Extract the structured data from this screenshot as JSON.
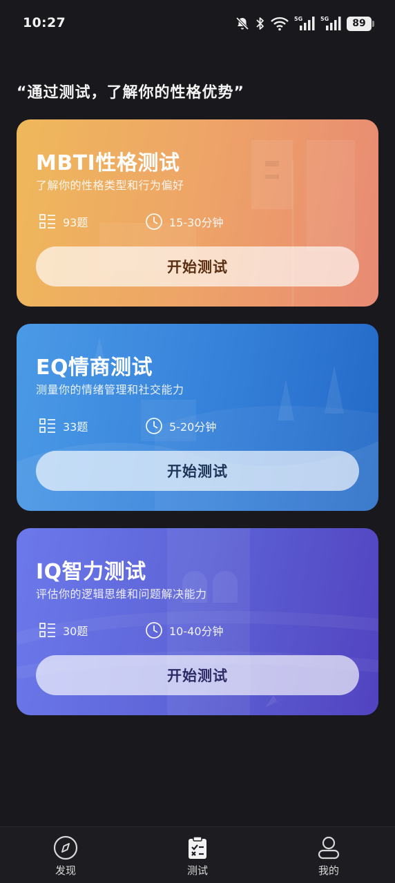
{
  "status_bar": {
    "time": "10:27",
    "icons": [
      "mute-bell-icon",
      "bluetooth-icon",
      "wifi-icon",
      "signal-5g-icon",
      "signal-5g-icon",
      "battery-icon"
    ],
    "network_label": "5G",
    "battery_level": "89"
  },
  "heading": "“通过测试，了解你的性格优势”",
  "tests": [
    {
      "title": "MBTI性格测试",
      "subtitle": "了解你的性格类型和行为偏好",
      "questions": "93题",
      "duration": "15-30分钟",
      "button": "开始测试",
      "colors": [
        "#efb85b",
        "#e88a74"
      ]
    },
    {
      "title": "EQ情商测试",
      "subtitle": "测量你的情绪管理和社交能力",
      "questions": "33题",
      "duration": "5-20分钟",
      "button": "开始测试",
      "colors": [
        "#4b9ae6",
        "#2369c7"
      ]
    },
    {
      "title": "IQ智力测试",
      "subtitle": "评估你的逻辑思维和问题解决能力",
      "questions": "30题",
      "duration": "10-40分钟",
      "button": "开始测试",
      "colors": [
        "#6c79ea",
        "#5243c0"
      ]
    }
  ],
  "bottom_nav": {
    "items": [
      {
        "label": "发现",
        "icon": "compass-icon"
      },
      {
        "label": "测试",
        "icon": "clipboard-check-icon",
        "active": true
      },
      {
        "label": "我的",
        "icon": "person-icon"
      }
    ]
  },
  "colors": {
    "background": "#19181d",
    "nav_background": "#1d1c21",
    "text": "#ffffff"
  }
}
